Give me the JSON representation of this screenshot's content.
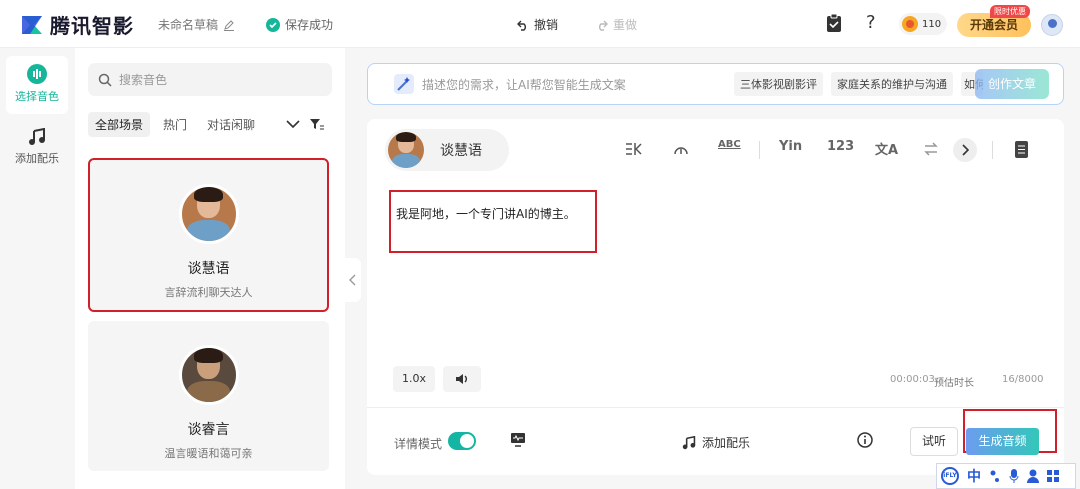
{
  "app": {
    "logo_text": "腾讯智影",
    "draft_name": "未命名草稿",
    "save_status": "保存成功",
    "undo_label": "撤销",
    "redo_label": "重做",
    "coin_count": "110",
    "vip_label": "开通会员",
    "vip_badge": "限时优惠",
    "help_glyph": "?"
  },
  "rail": {
    "items": [
      {
        "label": "选择音色"
      },
      {
        "label": "添加配乐"
      }
    ]
  },
  "voices": {
    "search_placeholder": "搜索音色",
    "filters": [
      "全部场景",
      "热门",
      "对话闲聊"
    ],
    "cards": [
      {
        "name": "谈慧语",
        "desc": "言辞流利聊天达人"
      },
      {
        "name": "谈睿言",
        "desc": "温言暖语和蔼可亲"
      }
    ]
  },
  "ai_bar": {
    "placeholder": "描述您的需求，让AI帮您智能生成文案",
    "chips": [
      "三体影视剧影评",
      "家庭关系的维护与沟通",
      "如何"
    ],
    "button_label": "创作文章"
  },
  "editor": {
    "speaker_name": "谈慧语",
    "tools": [
      "ABC",
      "Yin",
      "123",
      "文A"
    ],
    "text": "我是阿地，一个专门讲AI的博主。",
    "speed_label": "1.0x",
    "time": "00:00:03",
    "time_caption": "预估时长",
    "char_count": "16/8000",
    "detail_mode_label": "详情模式",
    "add_music_label": "添加配乐",
    "try_label": "试听",
    "generate_label": "生成音频"
  },
  "ime": {
    "logo": "iFLY",
    "lang": "中"
  },
  "colors": {
    "accent": "#15b69a",
    "highlight": "#d0212a"
  }
}
